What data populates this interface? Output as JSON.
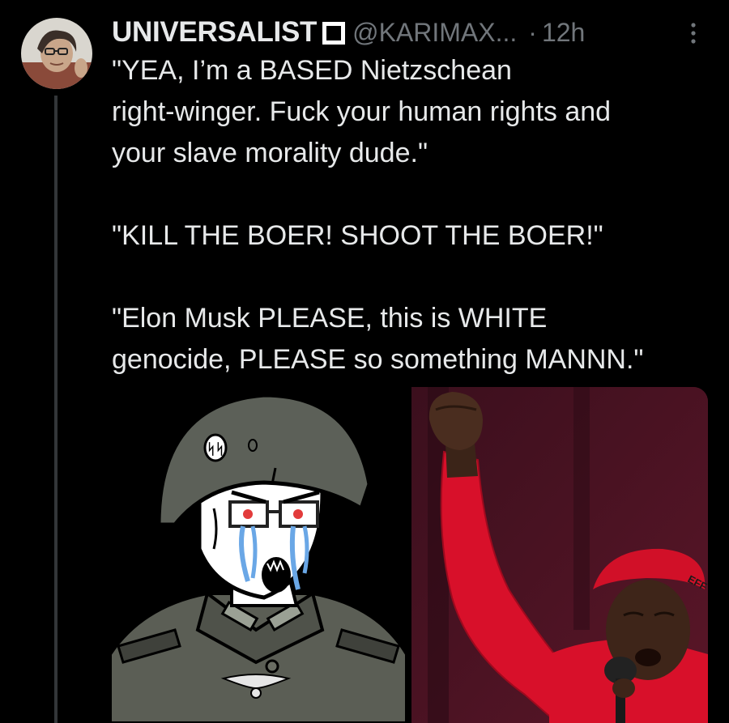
{
  "tweet": {
    "author": {
      "display_name": "UNIVERSALIST",
      "badge_icon": "square-badge-icon",
      "handle": "@KARIMAX...",
      "separator": "·",
      "timestamp": "12h"
    },
    "more_icon": "more-vertical-icon",
    "text_lines": [
      "\"YEA, I’m a BASED Nietzschean",
      "right-winger. Fuck your human rights and",
      "your slave morality dude.\"",
      "\"KILL THE BOER! SHOOT THE BOER!\"",
      "\"Elon Musk PLEASE, this is WHITE",
      "genocide, PLEASE so something MANNN.\""
    ],
    "media": [
      {
        "kind": "cartoon",
        "icon": "crying-soldier-cartoon-image",
        "caption_marks": "ᛋᛋ"
      },
      {
        "kind": "photo",
        "icon": "raised-fist-speaker-photo",
        "cap_text": "EFF"
      }
    ],
    "colors": {
      "background": "#000000",
      "text_primary": "#e7e9ea",
      "text_secondary": "#71767b",
      "thread_line": "#333639"
    }
  }
}
